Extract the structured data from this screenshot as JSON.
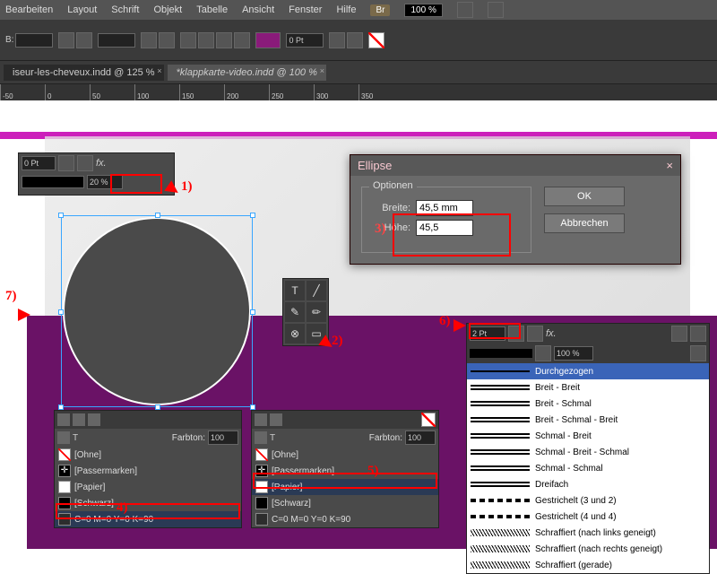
{
  "menu": {
    "items": [
      "Bearbeiten",
      "Layout",
      "Schrift",
      "Objekt",
      "Tabelle",
      "Ansicht",
      "Fenster",
      "Hilfe"
    ],
    "br": "Br",
    "zoom": "100 %"
  },
  "toolbar": {
    "b_label": "B:",
    "pt": "0 Pt"
  },
  "tabs": {
    "t1": "iseur-les-cheveux.indd @ 125 %",
    "t2": "*klappkarte-video.indd @ 100 %"
  },
  "ruler": {
    "marks": [
      "-50",
      "0",
      "50",
      "100",
      "150",
      "200",
      "250",
      "300",
      "350"
    ]
  },
  "annotations": {
    "a1": "1)",
    "a2": "2)",
    "a3": "3)",
    "a4": "4)",
    "a5": "5)",
    "a6": "6)",
    "a7": "7)"
  },
  "effects_panel": {
    "pt": "0 Pt",
    "opacity": "20 %"
  },
  "dialog": {
    "title": "Ellipse",
    "group": "Optionen",
    "width_label": "Breite:",
    "width_value": "45,5 mm",
    "height_label": "Höhe:",
    "height_value": "45,5",
    "ok": "OK",
    "cancel": "Abbrechen"
  },
  "swatches": {
    "tint_label": "Farbton:",
    "tint_value": "100",
    "none": "[Ohne]",
    "reg": "[Passermarken]",
    "paper": "[Papier]",
    "black": "[Schwarz]",
    "cmyk": "C=0 M=0 Y=0 K=90"
  },
  "stroke_panel": {
    "weight": "2 Pt",
    "opacity": "100 %"
  },
  "stroke_types": [
    "Durchgezogen",
    "Breit - Breit",
    "Breit - Schmal",
    "Breit - Schmal - Breit",
    "Schmal - Breit",
    "Schmal - Breit - Schmal",
    "Schmal - Schmal",
    "Dreifach",
    "Gestrichelt (3 und 2)",
    "Gestrichelt (4 und 4)",
    "Schraffiert (nach links geneigt)",
    "Schraffiert (nach rechts geneigt)",
    "Schraffiert (gerade)"
  ],
  "chart_data": null
}
